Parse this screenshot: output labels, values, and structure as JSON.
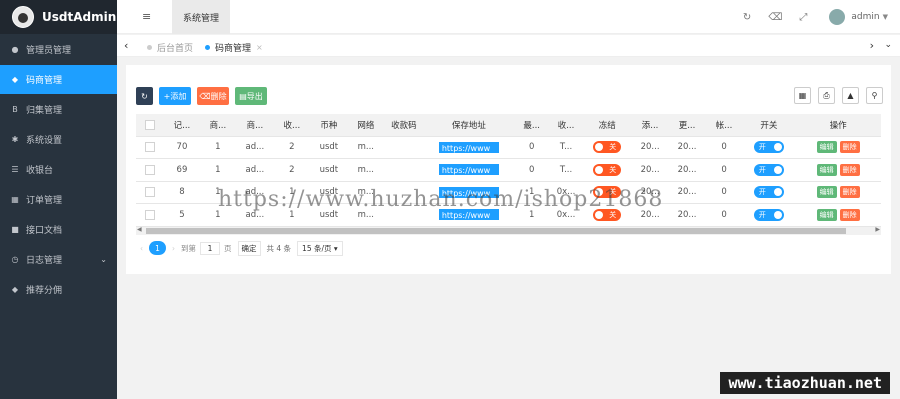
{
  "app": {
    "title": "UsdtAdmin"
  },
  "sidebar": {
    "items": [
      {
        "label": "管理员管理",
        "icon": "user-icon"
      },
      {
        "label": "码商管理",
        "icon": "diamond-icon"
      },
      {
        "label": "归集管理",
        "icon": "bitcoin-icon"
      },
      {
        "label": "系统设置",
        "icon": "gear-icon"
      },
      {
        "label": "收银台",
        "icon": "list-icon"
      },
      {
        "label": "订单管理",
        "icon": "calendar-icon"
      },
      {
        "label": "接口文档",
        "icon": "doc-icon"
      },
      {
        "label": "日志管理",
        "icon": "clock-icon"
      },
      {
        "label": "推荐分佣",
        "icon": "diamond-icon"
      }
    ],
    "active_index": 1
  },
  "header": {
    "module_tab": "系统管理",
    "username": "admin",
    "icons": [
      "refresh-icon",
      "clear-icon",
      "fullscreen-icon"
    ]
  },
  "tabs": {
    "home": "后台首页",
    "current": "码商管理",
    "close_glyph": "×"
  },
  "toolbar": {
    "add_label": "添加",
    "delete_label": "删除",
    "export_label": "导出"
  },
  "table": {
    "columns": [
      "",
      "记...",
      "商...",
      "商...",
      "收...",
      "币种",
      "网络",
      "收款码",
      "保存地址",
      "最...",
      "收...",
      "冻结",
      "添...",
      "更...",
      "帐...",
      "开关",
      "操作"
    ],
    "rows": [
      {
        "id": "70",
        "merchant_id": "1",
        "merchant": "ad...",
        "recv": "2",
        "coin": "usdt",
        "network": "m...",
        "qrcode": "",
        "address": "https://www",
        "min": "0",
        "recv2": "T...",
        "frozen": "关",
        "added": "20...",
        "updated": "20...",
        "account": "0",
        "switch": "开"
      },
      {
        "id": "69",
        "merchant_id": "1",
        "merchant": "ad...",
        "recv": "2",
        "coin": "usdt",
        "network": "m...",
        "qrcode": "",
        "address": "https://www",
        "min": "0",
        "recv2": "T...",
        "frozen": "关",
        "added": "20...",
        "updated": "20...",
        "account": "0",
        "switch": "开"
      },
      {
        "id": "8",
        "merchant_id": "1",
        "merchant": "ad...",
        "recv": "1",
        "coin": "usdt",
        "network": "m...",
        "qrcode": "",
        "address": "https://www",
        "min": "1",
        "recv2": "0x...",
        "frozen": "关",
        "added": "20...",
        "updated": "20...",
        "account": "0",
        "switch": "开"
      },
      {
        "id": "5",
        "merchant_id": "1",
        "merchant": "ad...",
        "recv": "1",
        "coin": "usdt",
        "network": "m...",
        "qrcode": "",
        "address": "https://www",
        "min": "1",
        "recv2": "0x...",
        "frozen": "关",
        "added": "20...",
        "updated": "20...",
        "account": "0",
        "switch": "开"
      }
    ],
    "edit_label": "编辑",
    "delete_label": "删除"
  },
  "pagination": {
    "current_page": "1",
    "goto_label": "到第",
    "page_input": "1",
    "page_unit": "页",
    "confirm_label": "确定",
    "total_label": "共 4 条",
    "page_size": "15 条/页"
  },
  "watermark": "https://www.huzhan.com/ishop21868",
  "corner_watermark": "www.tiaozhuan.net",
  "colors": {
    "primary": "#1e9fff",
    "danger": "#ff5722",
    "success": "#5fb878",
    "sidebar": "#28333e"
  }
}
